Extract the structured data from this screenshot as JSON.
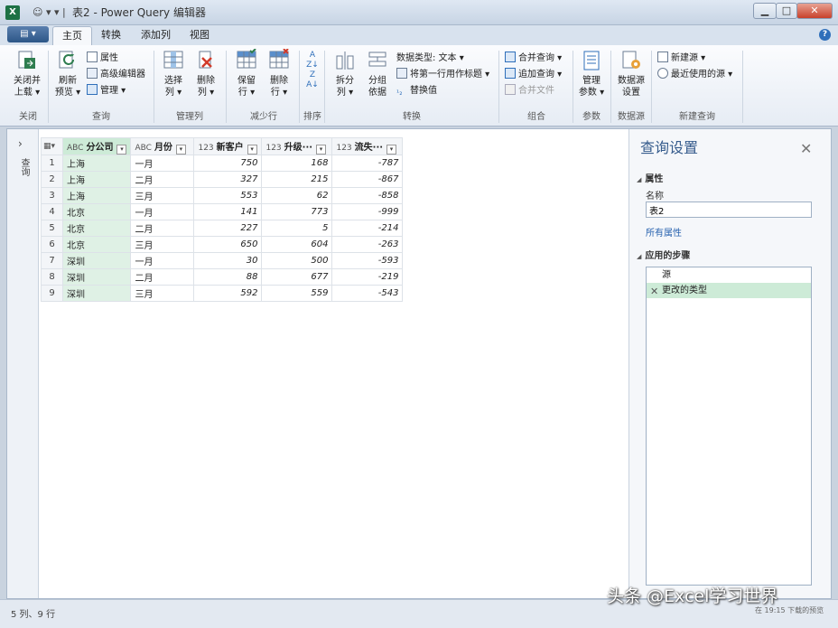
{
  "window": {
    "app_icon": "X",
    "qat": "☺ ▾ ▾ |",
    "title": "表2 - Power Query 编辑器",
    "min": "▁",
    "max": "□",
    "close": "✕"
  },
  "menu": {
    "file_label": "▤ ▾",
    "tabs": [
      {
        "label": "主页",
        "active": true
      },
      {
        "label": "转换",
        "active": false
      },
      {
        "label": "添加列",
        "active": false
      },
      {
        "label": "视图",
        "active": false
      }
    ],
    "help": "?"
  },
  "ribbon": {
    "close_load": "关闭并\n上载 ▾",
    "refresh_preview": "刷新\n预览 ▾",
    "properties": "属性",
    "advanced_editor": "高级编辑器",
    "manage": "管理 ▾",
    "choose_columns": "选择\n列 ▾",
    "remove_columns": "删除\n列 ▾",
    "keep_rows": "保留\n行 ▾",
    "remove_rows": "删除\n行 ▾",
    "split_column": "拆分\n列 ▾",
    "group_by": "分组\n依据",
    "data_type": "数据类型: 文本 ▾",
    "use_first_row": "将第一行用作标题 ▾",
    "replace_values": "替换值",
    "merge_queries": "合并查询 ▾",
    "append_queries": "追加查询 ▾",
    "combine_files": "合并文件",
    "manage_parameters": "管理\n参数 ▾",
    "data_source_settings": "数据源\n设置",
    "new_source": "新建源 ▾",
    "recent_sources": "最近使用的源 ▾",
    "groups": {
      "close": "关闭",
      "query": "查询",
      "manage_columns": "管理列",
      "reduce_rows": "减少行",
      "sort": "排序",
      "transform": "转换",
      "combine": "组合",
      "parameters": "参数",
      "data_sources": "数据源",
      "new_query": "新建查询"
    }
  },
  "queries_pane": {
    "label": "查询"
  },
  "table": {
    "corner_icon": "▦▾",
    "columns": [
      {
        "type_icon": "ABC",
        "name": "分公司",
        "selected": true
      },
      {
        "type_icon": "ABC",
        "name": "月份",
        "selected": false
      },
      {
        "type_icon": "123",
        "name": "新客户",
        "selected": false
      },
      {
        "type_icon": "123",
        "name": "升级···",
        "selected": false
      },
      {
        "type_icon": "123",
        "name": "流失···",
        "selected": false
      }
    ],
    "rows": [
      {
        "n": "1",
        "c": [
          "上海",
          "一月",
          "750",
          "168",
          "-787"
        ]
      },
      {
        "n": "2",
        "c": [
          "上海",
          "二月",
          "327",
          "215",
          "-867"
        ]
      },
      {
        "n": "3",
        "c": [
          "上海",
          "三月",
          "553",
          "62",
          "-858"
        ]
      },
      {
        "n": "4",
        "c": [
          "北京",
          "一月",
          "141",
          "773",
          "-999"
        ]
      },
      {
        "n": "5",
        "c": [
          "北京",
          "二月",
          "227",
          "5",
          "-214"
        ]
      },
      {
        "n": "6",
        "c": [
          "北京",
          "三月",
          "650",
          "604",
          "-263"
        ]
      },
      {
        "n": "7",
        "c": [
          "深圳",
          "一月",
          "30",
          "500",
          "-593"
        ]
      },
      {
        "n": "8",
        "c": [
          "深圳",
          "二月",
          "88",
          "677",
          "-219"
        ]
      },
      {
        "n": "9",
        "c": [
          "深圳",
          "三月",
          "592",
          "559",
          "-543"
        ]
      }
    ]
  },
  "query_settings": {
    "title": "查询设置",
    "close": "✕",
    "properties_header": "属性",
    "name_label": "名称",
    "name_value": "表2",
    "all_properties": "所有属性",
    "steps_header": "应用的步骤",
    "steps": [
      {
        "label": "源",
        "selected": false
      },
      {
        "label": "更改的类型",
        "selected": true
      }
    ],
    "step_delete": "✕"
  },
  "status": {
    "left": "5 列、9 行",
    "right": "在 19:15 下载的预览"
  },
  "watermark": "头条 @Excel学习世界",
  "colors": {
    "accent": "#355b8c",
    "selected_column": "#dff1e5",
    "selected_step": "#cdebd7"
  }
}
